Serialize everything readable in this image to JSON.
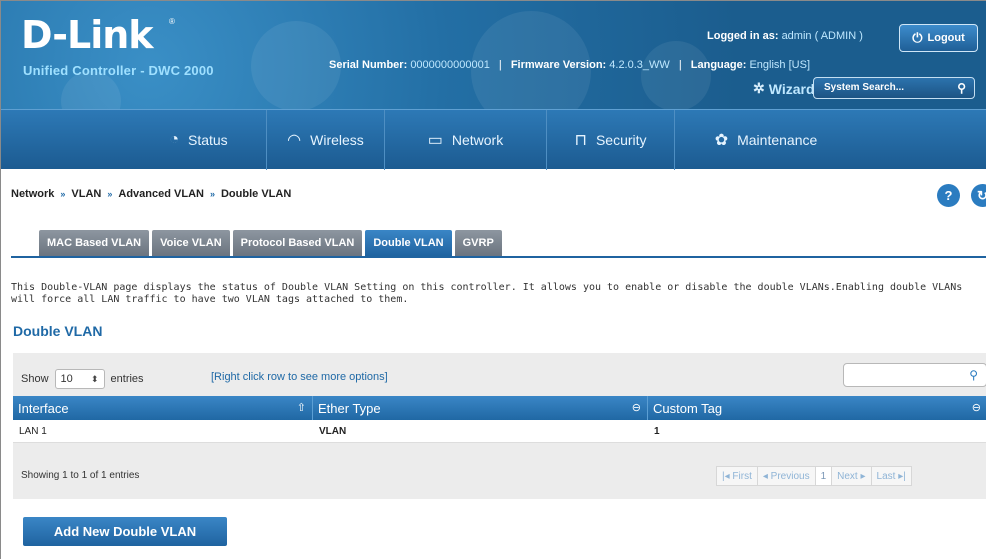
{
  "header": {
    "logo": "D-Link",
    "logo_reg": "®",
    "subtitle": "Unified Controller - DWC 2000",
    "serial_label": "Serial Number:",
    "serial_value": "0000000000001",
    "firmware_label": "Firmware Version:",
    "firmware_value": "4.2.0.3_WW",
    "language_label": "Language:",
    "language_value": "English [US]",
    "logged_label": "Logged in as:",
    "logged_value": "admin ( ADMIN )",
    "logout_label": "Logout",
    "wizard_label": "Wizard",
    "search_placeholder": "System Search..."
  },
  "nav": {
    "items": [
      {
        "label": "Status",
        "icon": "gauge-icon"
      },
      {
        "label": "Wireless",
        "icon": "wifi-icon"
      },
      {
        "label": "Network",
        "icon": "monitor-icon"
      },
      {
        "label": "Security",
        "icon": "lock-icon"
      },
      {
        "label": "Maintenance",
        "icon": "gears-icon"
      }
    ]
  },
  "breadcrumb": [
    "Network",
    "VLAN",
    "Advanced VLAN",
    "Double VLAN"
  ],
  "tabs": [
    "MAC Based VLAN",
    "Voice VLAN",
    "Protocol Based VLAN",
    "Double VLAN",
    "GVRP"
  ],
  "active_tab": "Double VLAN",
  "description": "This Double-VLAN page displays the status of Double VLAN Setting on this controller. It allows you to enable or disable the double VLANs.Enabling double VLANs will force all LAN traffic to have two VLAN tags attached to them.",
  "section_title": "Double VLAN",
  "table": {
    "show_label": "Show",
    "entries_value": "10",
    "entries_label": "entries",
    "right_click_hint": "[Right click row to see more options]",
    "columns": [
      "Interface",
      "Ether Type",
      "Custom Tag"
    ],
    "rows": [
      [
        "LAN 1",
        "VLAN",
        "1"
      ]
    ],
    "showing": "Showing 1 to 1 of 1 entries",
    "pager": {
      "first": "First",
      "previous": "Previous",
      "page": "1",
      "next": "Next",
      "last": "Last"
    }
  },
  "add_button": "Add New Double VLAN",
  "colors": {
    "brand_blue": "#236fa5",
    "accent_blue": "#1f69a6",
    "tab_gray": "#7a838d"
  }
}
